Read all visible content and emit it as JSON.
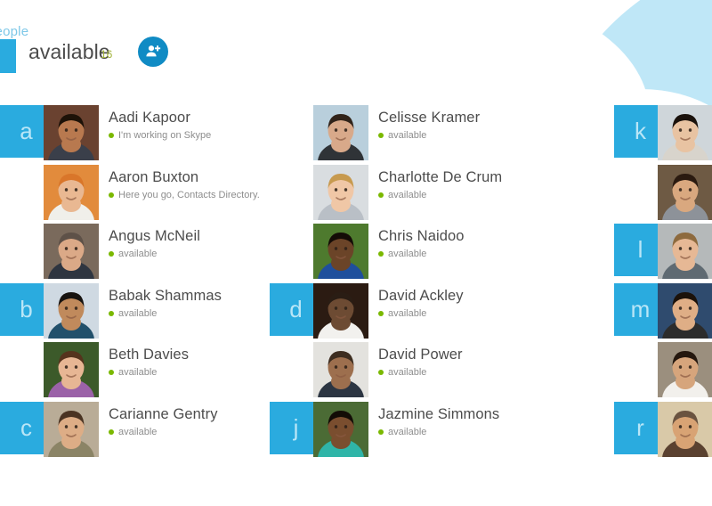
{
  "app": {
    "title": "people",
    "title_truncated": "ple"
  },
  "header": {
    "filter_label": "available",
    "filter_count": "16",
    "add_contact_icon": "add-person-icon",
    "add_contact_label": "Add a contact"
  },
  "colors": {
    "tile_blue": "#2aabdf",
    "tile_letter": "#b9e6f7",
    "accent_button": "#108bc4",
    "status_green": "#7ab800",
    "count_olive": "#a2b33a",
    "name_gray": "#4c4c4c",
    "status_gray": "#8d8d8d",
    "cloud_light": "#bfe7f7",
    "cloud_mid": "#7fd0ef",
    "cloud_dark": "#3fb5e5"
  },
  "columns": [
    {
      "rows": [
        {
          "letter": "a",
          "name": "Aadi Kapoor",
          "status": "I'm working on Skype",
          "avatar": "avatar-aadi-kapoor",
          "skin": "#b8794f",
          "bg": "#6a4230",
          "hair": "#1d1208",
          "shirt": "#3a3f4a"
        },
        {
          "letter": "",
          "name": "Aaron Buxton",
          "status": "Here you go, Contacts Directory.",
          "avatar": "avatar-aaron-buxton",
          "skin": "#e9b892",
          "bg": "#e28b3c",
          "hair": "#d9762a",
          "shirt": "#f0efea"
        },
        {
          "letter": "",
          "name": "Angus McNeil",
          "status": "available",
          "avatar": "avatar-angus-mcneil",
          "skin": "#dba987",
          "bg": "#7a6a5c",
          "hair": "#5e5148",
          "shirt": "#2e3540"
        },
        {
          "letter": "b",
          "name": "Babak Shammas",
          "status": "available",
          "avatar": "avatar-babak-shammas",
          "skin": "#c08a5c",
          "bg": "#cfd9e2",
          "hair": "#171310",
          "shirt": "#22506b"
        },
        {
          "letter": "",
          "name": "Beth Davies",
          "status": "available",
          "avatar": "avatar-beth-davies",
          "skin": "#e7b694",
          "bg": "#3c5a2a",
          "hair": "#55331d",
          "shirt": "#9b62a8"
        },
        {
          "letter": "c",
          "name": "Carianne Gentry",
          "status": "available",
          "avatar": "avatar-carianne-gentry",
          "skin": "#ddad86",
          "bg": "#b9ac97",
          "hair": "#4a3322",
          "shirt": "#8b8466"
        }
      ]
    },
    {
      "rows": [
        {
          "letter": "",
          "name": "Celisse Kramer",
          "status": "available",
          "avatar": "avatar-celisse-kramer",
          "skin": "#d8a98a",
          "bg": "#b9cfdc",
          "hair": "#30231a",
          "shirt": "#2f3337"
        },
        {
          "letter": "",
          "name": "Charlotte De Crum",
          "status": "available",
          "avatar": "avatar-charlotte-de-crum",
          "skin": "#f0c7a6",
          "bg": "#d9dde0",
          "hair": "#c79a4f",
          "shirt": "#b9bfc6"
        },
        {
          "letter": "",
          "name": "Chris Naidoo",
          "status": "available",
          "avatar": "avatar-chris-naidoo",
          "skin": "#6b4428",
          "bg": "#4e7a2e",
          "hair": "#140c06",
          "shirt": "#1f4f9c"
        },
        {
          "letter": "d",
          "name": "David Ackley",
          "status": "available",
          "avatar": "avatar-david-ackley",
          "skin": "#6d4b33",
          "bg": "#2b1b12",
          "hair": "#2a1d14",
          "shirt": "#f2f1ee"
        },
        {
          "letter": "",
          "name": "David Power",
          "status": "available",
          "avatar": "avatar-david-power",
          "skin": "#9d6f4e",
          "bg": "#e3e2de",
          "hair": "#3d2d20",
          "shirt": "#2c3542"
        },
        {
          "letter": "j",
          "name": "Jazmine Simmons",
          "status": "available",
          "avatar": "avatar-jazmine-simmons",
          "skin": "#7a4e2f",
          "bg": "#4b6b35",
          "hair": "#120c06",
          "shirt": "#2fb5a8"
        }
      ]
    },
    {
      "rows": [
        {
          "letter": "k",
          "name": "",
          "status": "",
          "avatar": "avatar-k-contact",
          "skin": "#e8c3a2",
          "bg": "#cfd6da",
          "hair": "#1a120c",
          "shirt": "#d8d4cc"
        },
        {
          "letter": "",
          "name": "",
          "status": "",
          "avatar": "avatar-k-contact-2",
          "skin": "#d9a87f",
          "bg": "#6e5a44",
          "hair": "#2a1a10",
          "shirt": "#8d9299"
        },
        {
          "letter": "l",
          "name": "",
          "status": "",
          "avatar": "avatar-l-contact",
          "skin": "#e6b895",
          "bg": "#b5b9ba",
          "hair": "#8d6a3e",
          "shirt": "#5f6a72"
        },
        {
          "letter": "m",
          "name": "",
          "status": "",
          "avatar": "avatar-m-contact",
          "skin": "#dfae86",
          "bg": "#2f4b6e",
          "hair": "#1c120a",
          "shirt": "#2c2c2c"
        },
        {
          "letter": "",
          "name": "",
          "status": "",
          "avatar": "avatar-m-contact-2",
          "skin": "#d6a57c",
          "bg": "#9b8f7e",
          "hair": "#24170e",
          "shirt": "#f2f0ec"
        },
        {
          "letter": "r",
          "name": "",
          "status": "",
          "avatar": "avatar-r-contact",
          "skin": "#d8a374",
          "bg": "#d9c9a8",
          "hair": "#6a5340",
          "shirt": "#5a4130"
        }
      ]
    }
  ]
}
